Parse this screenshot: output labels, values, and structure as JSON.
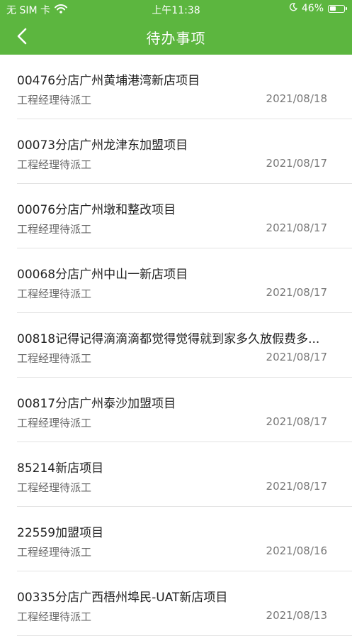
{
  "status_bar": {
    "carrier": "无 SIM 卡",
    "time": "上午11:38",
    "battery": "46%",
    "battery_level": 0.46
  },
  "nav": {
    "title": "待办事项"
  },
  "items": [
    {
      "title": "00476分店广州黄埔港湾新店项目",
      "subtitle": "工程经理待派工",
      "date": "2021/08/18"
    },
    {
      "title": "00073分店广州龙津东加盟项目",
      "subtitle": "工程经理待派工",
      "date": "2021/08/17"
    },
    {
      "title": "00076分店广州墩和整改项目",
      "subtitle": "工程经理待派工",
      "date": "2021/08/17"
    },
    {
      "title": "00068分店广州中山一新店项目",
      "subtitle": "工程经理待派工",
      "date": "2021/08/17"
    },
    {
      "title": "00818记得记得滴滴滴都觉得觉得就到家多久放假费多...",
      "subtitle": "工程经理待派工",
      "date": "2021/08/17"
    },
    {
      "title": "00817分店广州泰沙加盟项目",
      "subtitle": "工程经理待派工",
      "date": "2021/08/17"
    },
    {
      "title": "85214新店项目",
      "subtitle": "工程经理待派工",
      "date": "2021/08/17"
    },
    {
      "title": "22559加盟项目",
      "subtitle": "工程经理待派工",
      "date": "2021/08/16"
    },
    {
      "title": "00335分店广西梧州埠民-UAT新店项目",
      "subtitle": "工程经理待派工",
      "date": "2021/08/13"
    }
  ]
}
